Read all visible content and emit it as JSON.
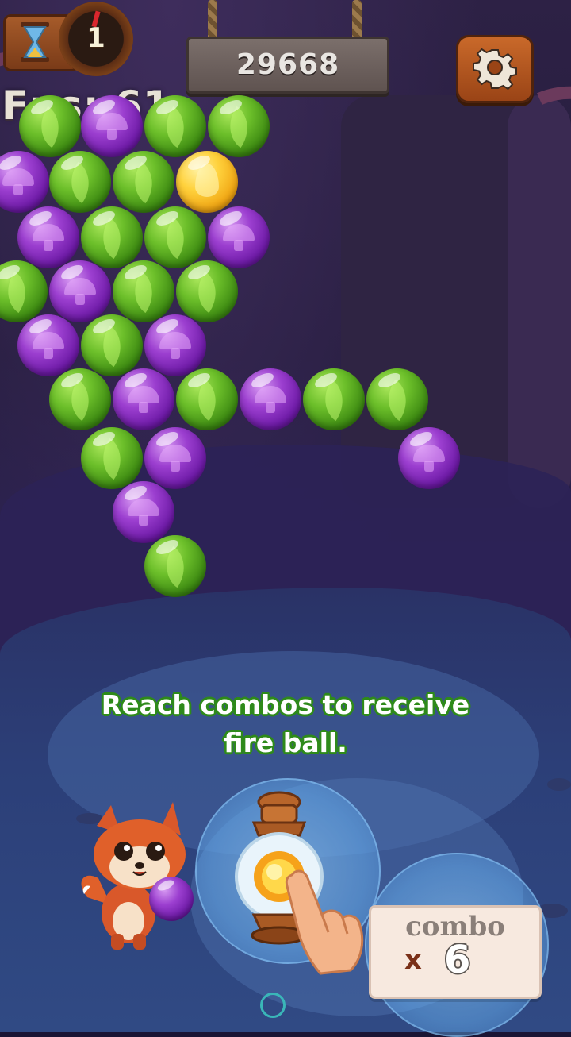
{
  "hud": {
    "level": "1",
    "score": "29668",
    "fps_label": "Fps: 61",
    "icons": {
      "timer": "hourglass-icon",
      "settings": "gear-icon"
    }
  },
  "bubbles": [
    {
      "color": "green",
      "symbol": "leaf"
    },
    {
      "color": "purple",
      "symbol": "mushroom"
    },
    {
      "color": "green",
      "symbol": "leaf"
    },
    {
      "color": "green",
      "symbol": "leaf"
    },
    {
      "color": "purple",
      "symbol": "mushroom"
    },
    {
      "color": "green",
      "symbol": "leaf"
    },
    {
      "color": "green",
      "symbol": "leaf"
    },
    {
      "color": "yellow",
      "symbol": "flame"
    },
    {
      "color": "purple",
      "symbol": "mushroom"
    },
    {
      "color": "green",
      "symbol": "leaf"
    },
    {
      "color": "green",
      "symbol": "leaf"
    },
    {
      "color": "purple",
      "symbol": "mushroom"
    },
    {
      "color": "green",
      "symbol": "leaf"
    },
    {
      "color": "purple",
      "symbol": "mushroom"
    },
    {
      "color": "green",
      "symbol": "leaf"
    },
    {
      "color": "green",
      "symbol": "leaf"
    },
    {
      "color": "purple",
      "symbol": "mushroom"
    },
    {
      "color": "green",
      "symbol": "leaf"
    },
    {
      "color": "purple",
      "symbol": "mushroom"
    },
    {
      "color": "green",
      "symbol": "leaf"
    },
    {
      "color": "purple",
      "symbol": "mushroom"
    },
    {
      "color": "green",
      "symbol": "leaf"
    },
    {
      "color": "purple",
      "symbol": "mushroom"
    },
    {
      "color": "green",
      "symbol": "leaf"
    },
    {
      "color": "green",
      "symbol": "leaf"
    },
    {
      "color": "green",
      "symbol": "leaf"
    },
    {
      "color": "purple",
      "symbol": "mushroom"
    },
    {
      "color": "purple",
      "symbol": "mushroom"
    },
    {
      "color": "purple",
      "symbol": "mushroom"
    },
    {
      "color": "green",
      "symbol": "leaf"
    }
  ],
  "tutorial": {
    "line1": "Reach combos to receive",
    "line2": "fire ball."
  },
  "combo": {
    "label": "combo",
    "prefix": "x",
    "count": "6"
  },
  "shooter": {
    "current_bubble": "purple",
    "character": "fox"
  },
  "colors": {
    "green": "#6cbf2a",
    "purple": "#9c3fd0",
    "yellow": "#ffd23d",
    "tutorial_outline": "#2e8a1a"
  }
}
